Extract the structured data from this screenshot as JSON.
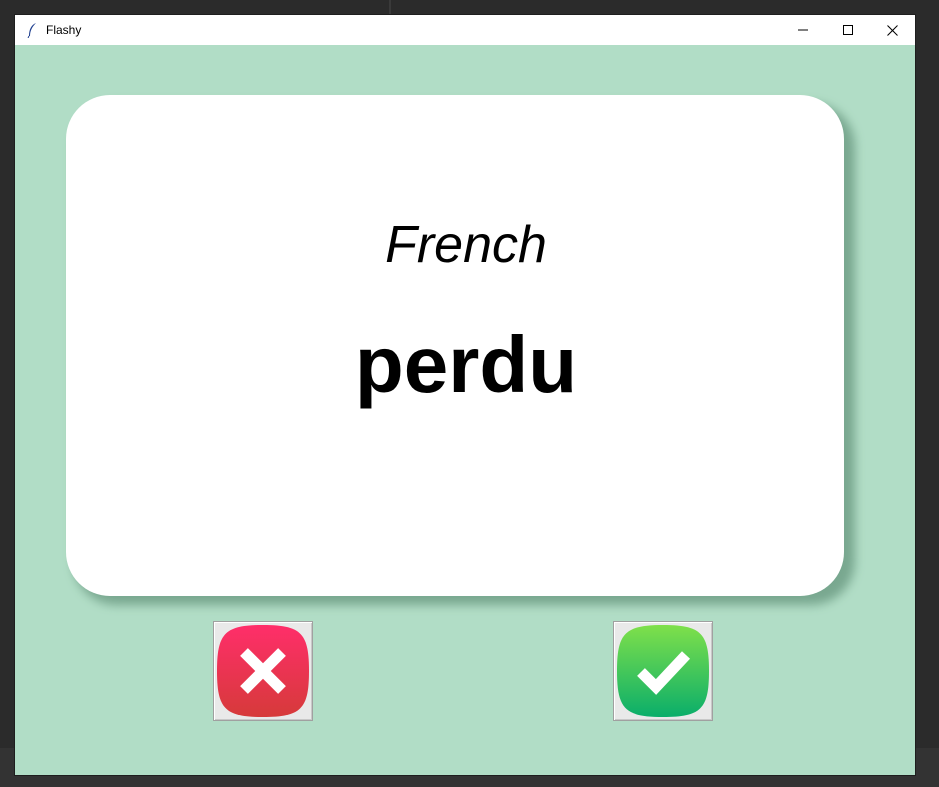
{
  "window": {
    "title": "Flashy",
    "controls": [
      "minimize-icon",
      "maximize-icon",
      "close-icon"
    ]
  },
  "card": {
    "language": "French",
    "word": "perdu"
  },
  "buttons": {
    "wrong_icon": "cross-icon",
    "right_icon": "checkmark-icon"
  },
  "colors": {
    "background": "#b1ddc6",
    "card": "#ffffff",
    "wrong": "#e8345a",
    "right": "#22c55e"
  }
}
